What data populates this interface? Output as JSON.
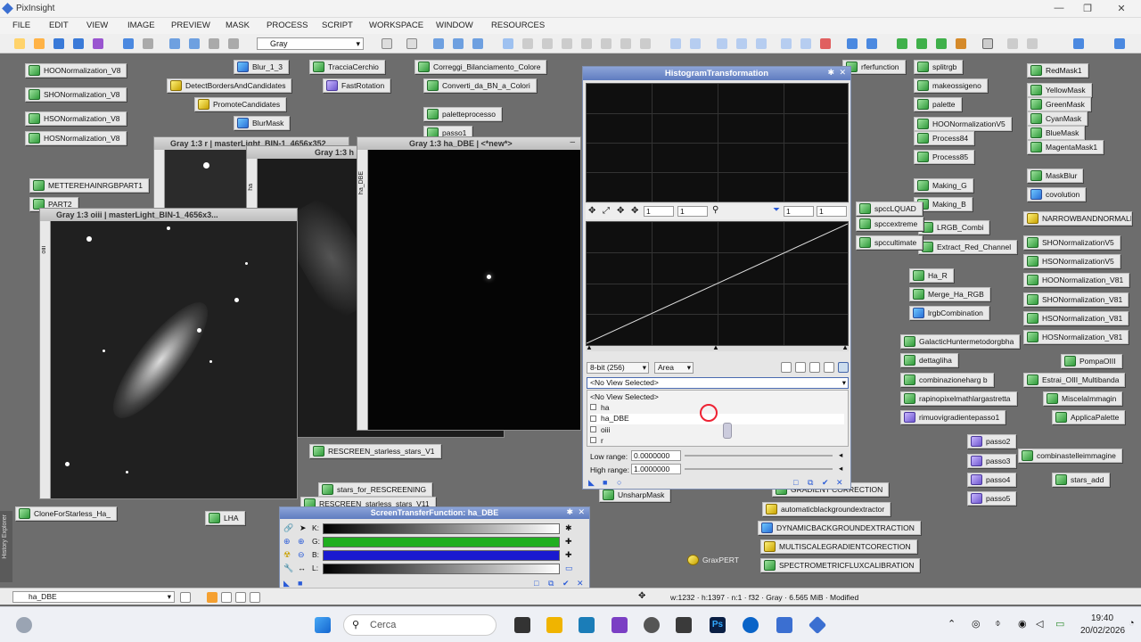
{
  "app": {
    "title": "PixInsight"
  },
  "menu": [
    "FILE",
    "EDIT",
    "VIEW",
    "IMAGE",
    "PREVIEW",
    "MASK",
    "PROCESS",
    "SCRIPT",
    "WORKSPACE",
    "WINDOW",
    "RESOURCES"
  ],
  "toolbar": {
    "color_space": "Gray"
  },
  "process_icons_left": [
    "HOONormalization_V8",
    "SHONormalization_V8",
    "HSONormalization_V8",
    "HOSNormalization_V8",
    "METTEREHAINRGBPART1",
    "PART2",
    "CloneForStarless_Ha_"
  ],
  "process_icons_top": [
    "Blur_1_3",
    "DetectBordersAndCandidates",
    "PromoteCandidates",
    "BlurMask",
    "TracciaCerchio",
    "FastRotation",
    "Correggi_Bilanciamento_Colore",
    "Converti_da_BN_a_Colori",
    "paletteprocesso",
    "passo1"
  ],
  "process_icons_right1": [
    "splitrgb",
    "makeossigeno",
    "palette",
    "HOONormalizationV5",
    "Process84",
    "Process85",
    "Making_G",
    "Making_B",
    "LRGB_Combi",
    "Extract_Red_Channel",
    "Ha_R",
    "Merge_Ha_RGB",
    "lrgbCombination",
    "GalacticHuntermetodorgbha",
    "dettagliha",
    "combinazioneharg b",
    "rapinopixelmathlargastretta",
    "rimuovigradientepasso1",
    "passo2",
    "passo3",
    "passo4",
    "passo5"
  ],
  "process_icons_right2": [
    "RedMask1",
    "YellowMask",
    "GreenMask",
    "CyanMask",
    "BlueMask",
    "MagentaMask1",
    "MaskBlur",
    "covolution",
    "NARROWBANDNORMALIZA",
    "SHONormalizationV5",
    "HSONormalizationV5",
    "HOONormalization_V81",
    "SHONormalization_V81",
    "HSONormalization_V81",
    "HOSNormalization_V81",
    "PompaOIII",
    "Estrai_OIII_Multibanda",
    "MiscelaImmagin",
    "ApplicaPalette",
    "combinastelleimmagine",
    "stars_add"
  ],
  "process_icons_misc": [
    "spccLQUAD",
    "spccextreme",
    "spccultimate",
    "rferfunction",
    "RESCREEN_starless_stars_V1",
    "stars_for_RESCREENING",
    "RESCREEN_starless_stars_V11",
    "LHA",
    "UnsharpMask",
    "GRADIENT CORRECTION",
    "automaticblackgroundextractor",
    "DYNAMICBACKGROUNDEXTRACTION",
    "MULTISCALEGRADIENTCORECTION",
    "SPECTROMETRICFLUXCALIBRATION",
    "GraxPERT"
  ],
  "windows": {
    "w1": "Gray 1:3 r | masterLight_BIN-1_4656x352",
    "w2": "Gray 1:3 h",
    "w3": "Gray 1:3 ha_DBE | <*new*>",
    "w4": "Gray 1:3 oiii | masterLight_BIN-1_4656x3...",
    "w3_side": "ha_DBE",
    "w4_side": "oiii",
    "w2_side": "ha"
  },
  "histogram": {
    "title": "HistogramTransformation",
    "zoom_x": "1",
    "zoom_y": "1",
    "zoom2_x": "1",
    "zoom2_y": "1",
    "bit_depth": "8-bit (256)",
    "mode": "Area",
    "view_select": "<No View Selected>",
    "view_list": [
      "<No View Selected>",
      "ha",
      "ha_DBE",
      "oiii",
      "r"
    ],
    "low_range_label": "Low range:",
    "low_range": "0.0000000",
    "high_range_label": "High range:",
    "high_range": "1.0000000"
  },
  "stf": {
    "title": "ScreenTransferFunction: ha_DBE",
    "channels": [
      "K:",
      "G:",
      "B:",
      "L:"
    ]
  },
  "statusbar": {
    "view": "ha_DBE",
    "info": "w:1232  ·  h:1397  ·  n:1  ·  f32  ·  Gray  ·  6.565 MiB  ·  Modified",
    "history_label": "History Explorer"
  },
  "taskbar": {
    "search": "Cerca",
    "time": "19:40",
    "date": "20/02/2026"
  }
}
